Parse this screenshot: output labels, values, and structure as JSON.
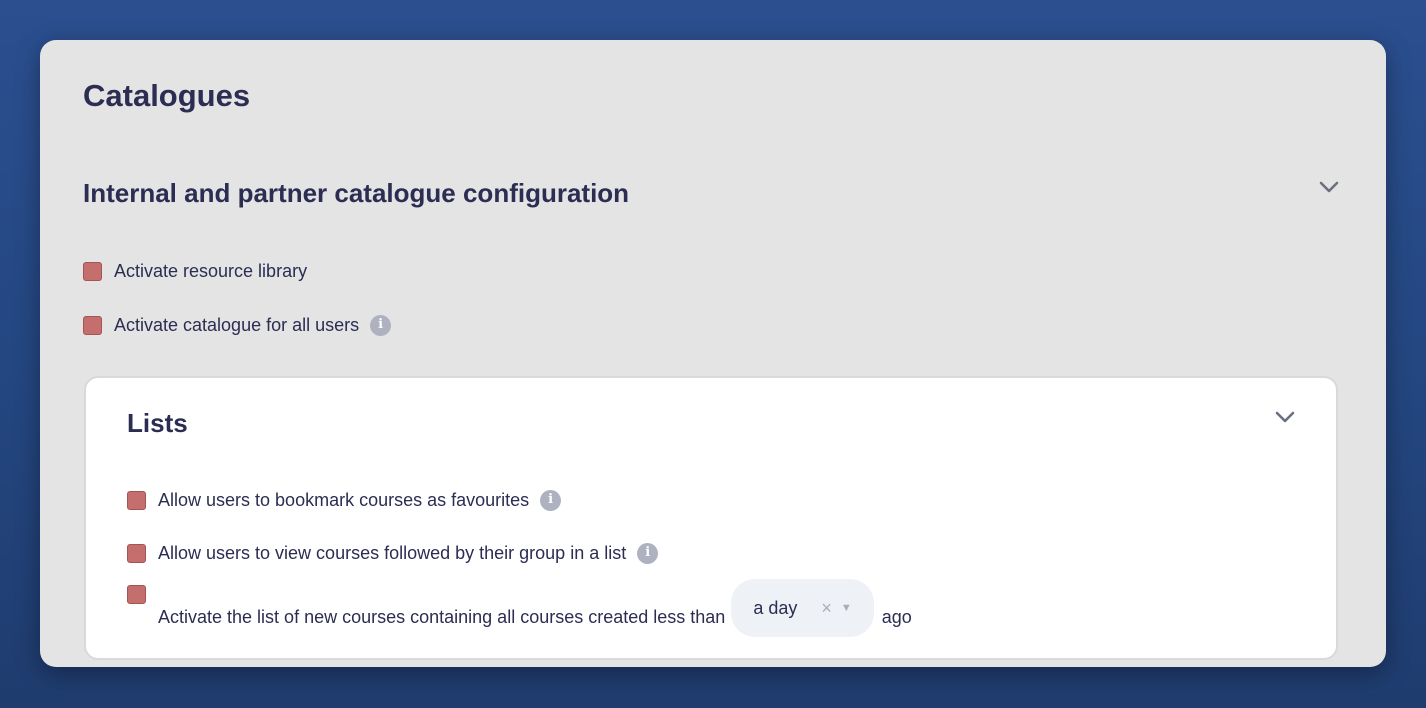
{
  "page": {
    "title": "Catalogues"
  },
  "section": {
    "title": "Internal and partner catalogue configuration",
    "options": [
      {
        "label": "Activate resource library",
        "checked": true
      },
      {
        "label": "Activate catalogue for all users",
        "checked": true
      }
    ]
  },
  "lists": {
    "title": "Lists",
    "options": [
      {
        "label": "Allow users to bookmark courses as favourites",
        "checked": true
      },
      {
        "label": "Allow users to view courses followed by their group in a list",
        "checked": true
      },
      {
        "label": "Activate the list of new courses containing all courses created less than",
        "checked": true,
        "suffix": "ago"
      }
    ],
    "period_select": {
      "value": "a day",
      "clear_glyph": "×",
      "caret_glyph": "▼"
    }
  },
  "icons": {
    "info": "info-icon",
    "chevron": "chevron-down-icon"
  },
  "colors": {
    "background": "#2b4f8f",
    "panel": "#e4e4e4",
    "card": "#ffffff",
    "checkbox": "#c46e6e",
    "text": "#2b2d52",
    "info_icon": "#aeb2c0"
  }
}
